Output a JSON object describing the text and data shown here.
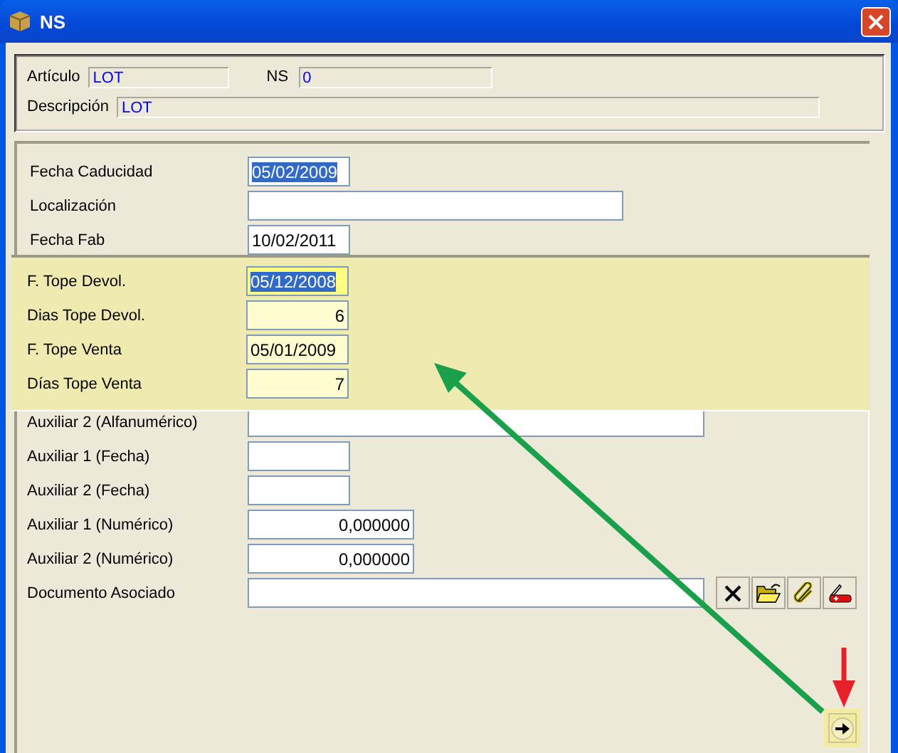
{
  "window": {
    "title": "NS"
  },
  "header": {
    "fields": [
      {
        "label": "Artículo",
        "value": "LOT",
        "kind": "short"
      },
      {
        "label": "NS",
        "value": "0",
        "kind": "medium"
      },
      {
        "label": "Descripción",
        "value": "LOT",
        "kind": "long"
      }
    ]
  },
  "form_top": [
    {
      "label": "Fecha Caducidad",
      "value": "05/02/2009",
      "kind": "date",
      "highlighted": true
    },
    {
      "label": "Localización",
      "kind": "text"
    },
    {
      "label": "Fecha Fab",
      "value": "10/02/2011",
      "kind": "date",
      "highlighted": false
    }
  ],
  "panel": [
    {
      "label": "F. Tope Devol.",
      "value": "05/12/2008",
      "kind": "date",
      "highlighted": true
    },
    {
      "label": "Dias Tope Devol.",
      "value": "6",
      "kind": "number",
      "highlighted": false
    },
    {
      "label": "F. Tope Venta",
      "value": "05/01/2009",
      "kind": "date",
      "highlighted": false
    },
    {
      "label": "Días Tope Venta",
      "value": "7",
      "kind": "number",
      "highlighted": false
    }
  ],
  "form_bottom": [
    {
      "label": "Auxiliar 2 (Alfanumérico)",
      "kind": "wide"
    },
    {
      "label": "Auxiliar 1 (Fecha)",
      "kind": "date"
    },
    {
      "label": "Auxiliar 2 (Fecha)",
      "kind": "date"
    },
    {
      "label": "Auxiliar 1 (Numérico)",
      "value": "0,000000",
      "kind": "decimal",
      "highlighted": false
    },
    {
      "label": "Auxiliar 2 (Numérico)",
      "value": "0,000000",
      "kind": "decimal",
      "highlighted": false
    },
    {
      "label": "Documento Asociado",
      "kind": "wide"
    }
  ],
  "document_tools": [
    {
      "kind": "delete"
    },
    {
      "kind": "open"
    },
    {
      "kind": "attach"
    },
    {
      "kind": "tool"
    }
  ]
}
